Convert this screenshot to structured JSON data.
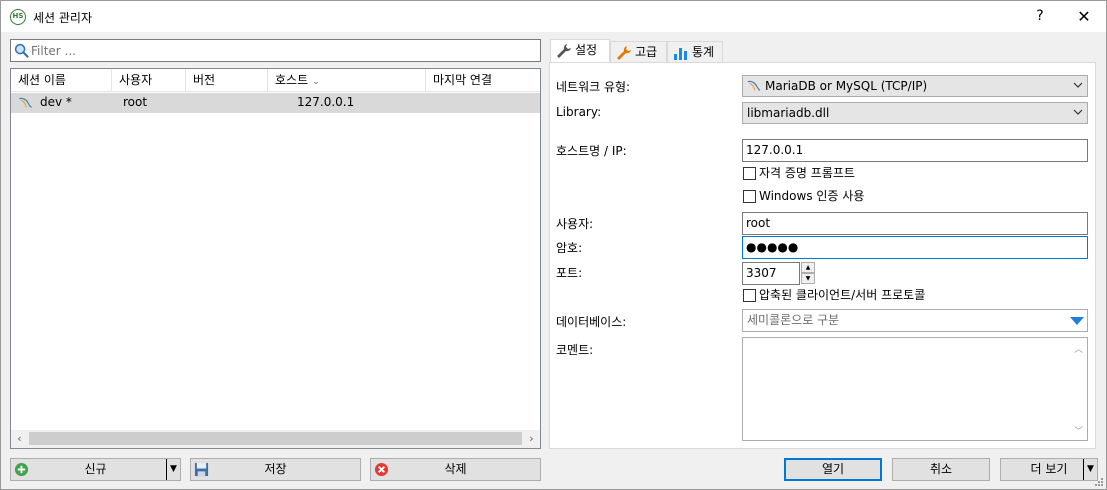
{
  "window": {
    "title": "세션 관리자",
    "help_label": "?",
    "close_label": "✕"
  },
  "filter": {
    "placeholder": "Filter ..."
  },
  "session_list": {
    "columns": [
      "세션 이름",
      "사용자",
      "버전",
      "호스트",
      "마지막 연결"
    ],
    "sorted_column_indicator": "⌄",
    "rows": [
      {
        "name": "dev *",
        "user": "root",
        "version": "",
        "host": "127.0.0.1",
        "last_connect": ""
      }
    ]
  },
  "left_buttons": {
    "new_label": "신규",
    "save_label": "저장",
    "delete_label": "삭제"
  },
  "tabs": [
    {
      "label": "설정",
      "icon": "wrench-icon",
      "active": true
    },
    {
      "label": "고급",
      "icon": "wrench-orange-icon",
      "active": false
    },
    {
      "label": "통계",
      "icon": "bar-chart-icon",
      "active": false
    }
  ],
  "settings": {
    "network_type_label": "네트워크 유형:",
    "network_type_value": "MariaDB or MySQL (TCP/IP)",
    "library_label": "Library:",
    "library_value": "libmariadb.dll",
    "host_label": "호스트명 / IP:",
    "host_value": "127.0.0.1",
    "prompt_credentials_label": "자격 증명 프롬프트",
    "windows_auth_label": "Windows 인증 사용",
    "user_label": "사용자:",
    "user_value": "root",
    "password_label": "암호:",
    "password_value": "●●●●●",
    "port_label": "포트:",
    "port_value": "3307",
    "compressed_label": "압축된 클라이언트/서버 프로토콜",
    "databases_label": "데이터베이스:",
    "databases_placeholder": "세미콜론으로 구분",
    "comment_label": "코멘트:"
  },
  "right_buttons": {
    "open_label": "열기",
    "cancel_label": "취소",
    "more_label": "더 보기"
  },
  "colors": {
    "accent": "#0078d7",
    "row_selected": "#d9d9d9",
    "green_icon": "#2e7d32",
    "delete_red": "#e53935"
  }
}
